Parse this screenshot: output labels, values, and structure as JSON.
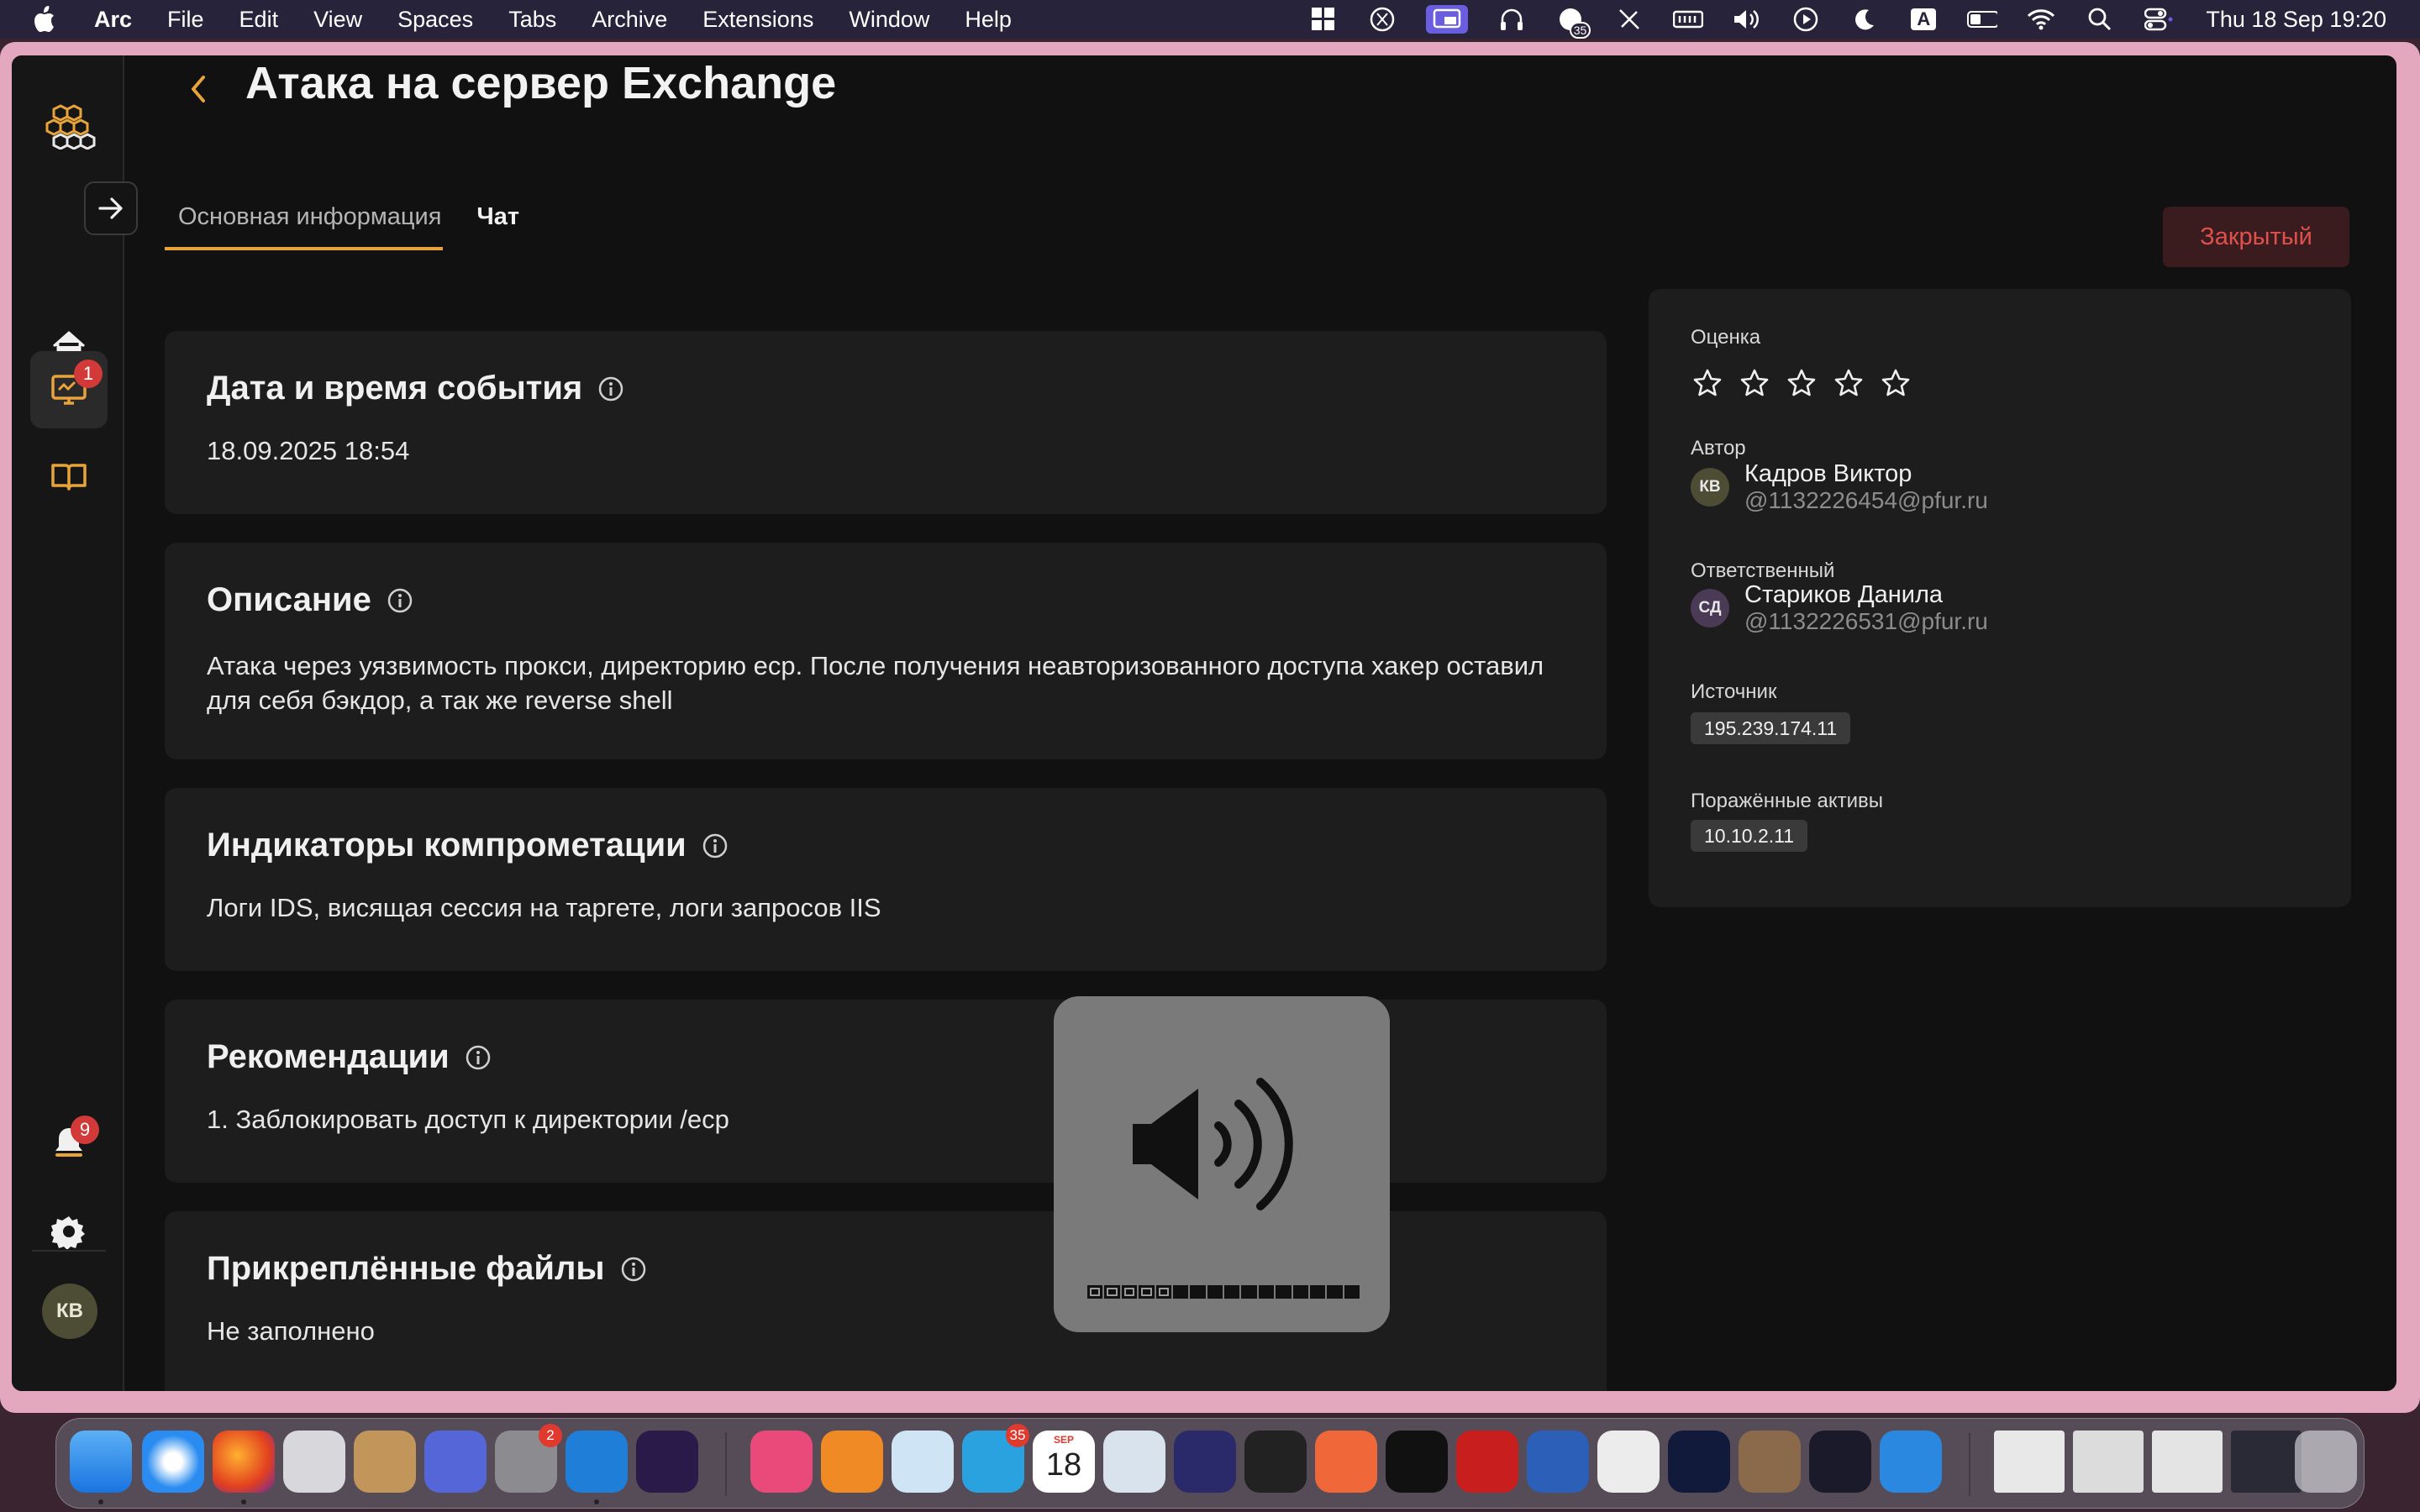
{
  "menubar": {
    "items": [
      "Arc",
      "File",
      "Edit",
      "View",
      "Spaces",
      "Tabs",
      "Archive",
      "Extensions",
      "Window",
      "Help"
    ],
    "clock": "Thu 18 Sep  19:20",
    "status_badge": "35",
    "input_source": "A"
  },
  "sidebar": {
    "monitor_badge": "1",
    "bell_badge": "9",
    "avatar_initials": "КВ"
  },
  "header": {
    "title": "Атака на сервер Exchange",
    "tabs": [
      {
        "label": "Основная информация",
        "active": true
      },
      {
        "label": "Чат",
        "active": false
      }
    ],
    "status_label": "Закрытый"
  },
  "sections": {
    "datetime": {
      "title": "Дата и время события",
      "value": "18.09.2025 18:54"
    },
    "description": {
      "title": "Описание",
      "value": "Атака через уязвимость прокси, директорию ecp. После получения неавторизованного доступа хакер оставил для себя бэкдор, а так же reverse shell"
    },
    "indicators": {
      "title": "Индикаторы компрометации",
      "value": "Логи IDS, висящая сессия на таргете, логи запросов IIS"
    },
    "recommendations": {
      "title": "Рекомендации",
      "value": "1. Заблокировать доступ к директории /ecp"
    },
    "files": {
      "title": "Прикреплённые файлы",
      "value": "Не заполнено"
    }
  },
  "details": {
    "rating_label": "Оценка",
    "rating": {
      "value": 0,
      "max": 5
    },
    "author_label": "Автор",
    "author": {
      "initials": "КВ",
      "name": "Кадров Виктор",
      "handle": "@1132226454@pfur.ru"
    },
    "responsible_label": "Ответственный",
    "responsible": {
      "initials": "СД",
      "name": "Стариков Данила",
      "handle": "@1132226531@pfur.ru"
    },
    "source_label": "Источник",
    "source": "195.239.174.11",
    "assets_label": "Поражённые активы",
    "assets": [
      "10.10.2.11"
    ]
  },
  "volume_hud": {
    "level": 0.31
  },
  "dock": {
    "settings_badge": "2",
    "telegram_badge": "35",
    "calendar_month": "SEP",
    "calendar_day": "18"
  },
  "colors": {
    "accent": "#e8a43a",
    "status_bg": "#3a1c1f",
    "status_text": "#e0504c",
    "card_bg": "#1d1d1d",
    "app_bg": "#111111"
  }
}
